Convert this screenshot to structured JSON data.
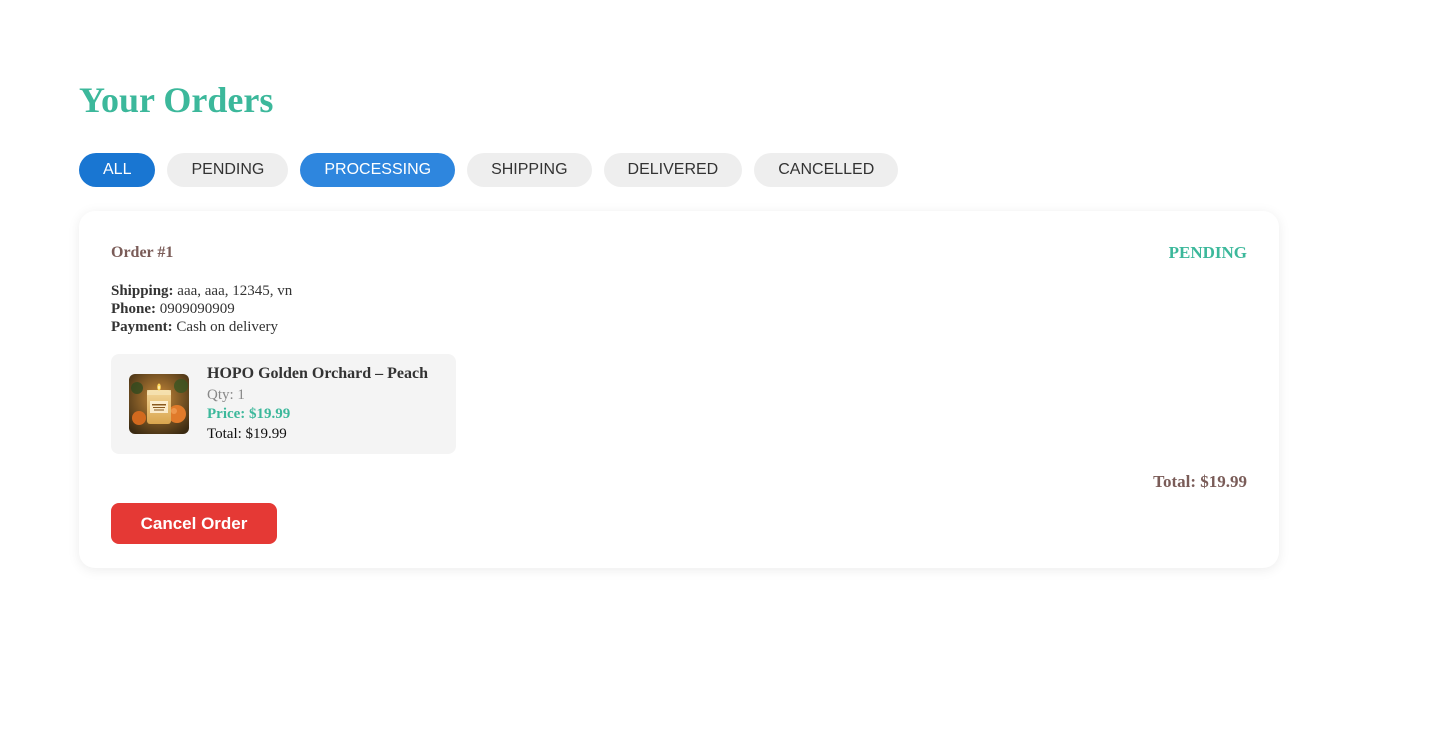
{
  "page": {
    "title": "Your Orders"
  },
  "filters": [
    {
      "label": "ALL",
      "state": "active-primary"
    },
    {
      "label": "PENDING",
      "state": "inactive"
    },
    {
      "label": "PROCESSING",
      "state": "active-secondary"
    },
    {
      "label": "SHIPPING",
      "state": "inactive"
    },
    {
      "label": "DELIVERED",
      "state": "inactive"
    },
    {
      "label": "CANCELLED",
      "state": "inactive"
    }
  ],
  "order": {
    "id_label": "Order #1",
    "status": "PENDING",
    "shipping_label": "Shipping:",
    "shipping_value": " aaa, aaa, 12345, vn",
    "phone_label": "Phone:",
    "phone_value": " 0909090909",
    "payment_label": "Payment:",
    "payment_value": " Cash on delivery",
    "items": [
      {
        "name": "HOPO Golden Orchard – Peach",
        "qty": "Qty: 1",
        "price": "Price: $19.99",
        "total": "Total: $19.99",
        "thumb_icon": "peach-candle-product-image"
      }
    ],
    "total": "Total: $19.99",
    "cancel_label": "Cancel Order"
  },
  "colors": {
    "accent": "#3cb89b",
    "primary_blue": "#1976d2",
    "secondary_blue": "#2e86de",
    "danger": "#e53935",
    "brown": "#7a5c58"
  }
}
